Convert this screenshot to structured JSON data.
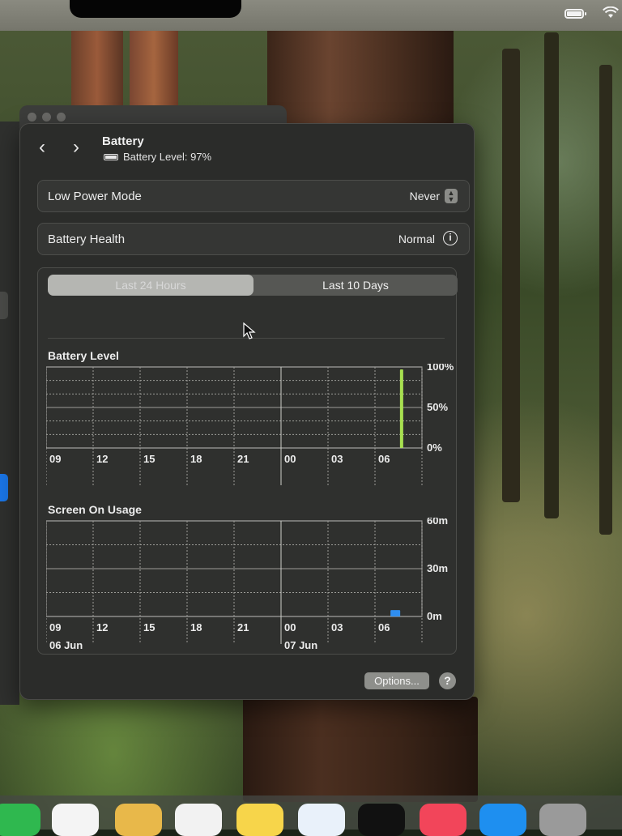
{
  "header": {
    "title": "Battery",
    "battery_level": "Battery Level: 97%",
    "back_glyph": "‹",
    "forward_glyph": "›"
  },
  "settings": {
    "low_power_mode": {
      "label": "Low Power Mode",
      "value": "Never"
    },
    "battery_health": {
      "label": "Battery Health",
      "value": "Normal"
    }
  },
  "tabs": [
    {
      "label": "Last 24 Hours",
      "selected": true
    },
    {
      "label": "Last 10 Days",
      "selected": false
    }
  ],
  "chart_data": [
    {
      "type": "bar",
      "title": "Battery Level",
      "categories": [
        "09",
        "12",
        "15",
        "18",
        "21",
        "00",
        "03",
        "06"
      ],
      "y_ticks": [
        "100%",
        "50%",
        "0%"
      ],
      "ylim": [
        0,
        100
      ],
      "values": [
        97
      ],
      "value_positions_hours_after_09": [
        22.7
      ],
      "color": "#a8e050",
      "grid": true
    },
    {
      "type": "bar",
      "title": "Screen On Usage",
      "categories": [
        "09",
        "12",
        "15",
        "18",
        "21",
        "00",
        "03",
        "06"
      ],
      "date_labels": [
        {
          "at": "09",
          "text": "06 Jun"
        },
        {
          "at": "00",
          "text": "07 Jun"
        }
      ],
      "y_ticks": [
        "60m",
        "30m",
        "0m"
      ],
      "ylim": [
        0,
        60
      ],
      "values": [
        4
      ],
      "value_positions_hours_after_09": [
        22.3
      ],
      "color": "#2f8ef0",
      "grid": true
    }
  ],
  "footer": {
    "options_label": "Options...",
    "help_label": "?"
  },
  "icons": [
    "battery-icon",
    "wifi-icon",
    "info-icon",
    "stepper-icon",
    "cursor-icon"
  ]
}
